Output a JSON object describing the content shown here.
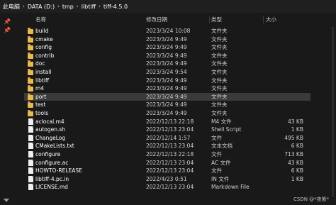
{
  "address": {
    "crumbs": [
      "此电脑",
      "DATA (D:)",
      "tmp",
      "libtiff",
      "tiff-4.5.0"
    ],
    "separator": "›"
  },
  "columns": {
    "name": "名称",
    "date": "修改日期",
    "type": "类型",
    "size": "大小"
  },
  "nav": {
    "pins": [
      "📌",
      "📌"
    ]
  },
  "files": [
    {
      "name": "build",
      "date": "2023/3/24 10:08",
      "type": "文件夹",
      "size": "",
      "kind": "folder"
    },
    {
      "name": "cmake",
      "date": "2023/3/24 9:49",
      "type": "文件夹",
      "size": "",
      "kind": "folder"
    },
    {
      "name": "config",
      "date": "2023/3/24 9:49",
      "type": "文件夹",
      "size": "",
      "kind": "folder"
    },
    {
      "name": "contrib",
      "date": "2023/3/24 9:49",
      "type": "文件夹",
      "size": "",
      "kind": "folder"
    },
    {
      "name": "doc",
      "date": "2023/3/24 9:49",
      "type": "文件夹",
      "size": "",
      "kind": "folder"
    },
    {
      "name": "install",
      "date": "2023/3/24 9:54",
      "type": "文件夹",
      "size": "",
      "kind": "folder"
    },
    {
      "name": "libtiff",
      "date": "2023/3/24 9:49",
      "type": "文件夹",
      "size": "",
      "kind": "folder"
    },
    {
      "name": "m4",
      "date": "2023/3/24 9:49",
      "type": "文件夹",
      "size": "",
      "kind": "folder"
    },
    {
      "name": "port",
      "date": "2023/3/24 9:49",
      "type": "文件夹",
      "size": "",
      "kind": "folder",
      "selected": true
    },
    {
      "name": "test",
      "date": "2023/3/24 9:49",
      "type": "文件夹",
      "size": "",
      "kind": "folder"
    },
    {
      "name": "tools",
      "date": "2023/3/24 9:49",
      "type": "文件夹",
      "size": "",
      "kind": "folder"
    },
    {
      "name": "aclocal.m4",
      "date": "2022/12/13 22:18",
      "type": "M4 文件",
      "size": "43 KB",
      "kind": "file"
    },
    {
      "name": "autogen.sh",
      "date": "2022/12/13 23:04",
      "type": "Shell Script",
      "size": "1 KB",
      "kind": "file"
    },
    {
      "name": "ChangeLog",
      "date": "2022/12/14 1:57",
      "type": "文件",
      "size": "495 KB",
      "kind": "file"
    },
    {
      "name": "CMakeLists.txt",
      "date": "2022/12/13 23:04",
      "type": "文本文档",
      "size": "6 KB",
      "kind": "file"
    },
    {
      "name": "configure",
      "date": "2022/12/13 22:18",
      "type": "文件",
      "size": "713 KB",
      "kind": "file"
    },
    {
      "name": "configure.ac",
      "date": "2022/12/13 23:04",
      "type": "AC 文件",
      "size": "43 KB",
      "kind": "file"
    },
    {
      "name": "HOWTO-RELEASE",
      "date": "2022/12/13 23:04",
      "type": "文件",
      "size": "6 KB",
      "kind": "file"
    },
    {
      "name": "libtiff-4.pc.in",
      "date": "2022/4/23 0:51",
      "type": "IN 文件",
      "size": "1 KB",
      "kind": "file"
    },
    {
      "name": "LICENSE.md",
      "date": "2022/12/13 23:04",
      "type": "Markdown File",
      "size": "",
      "kind": "file"
    }
  ],
  "watermark": "CSDN @*夜紫*"
}
